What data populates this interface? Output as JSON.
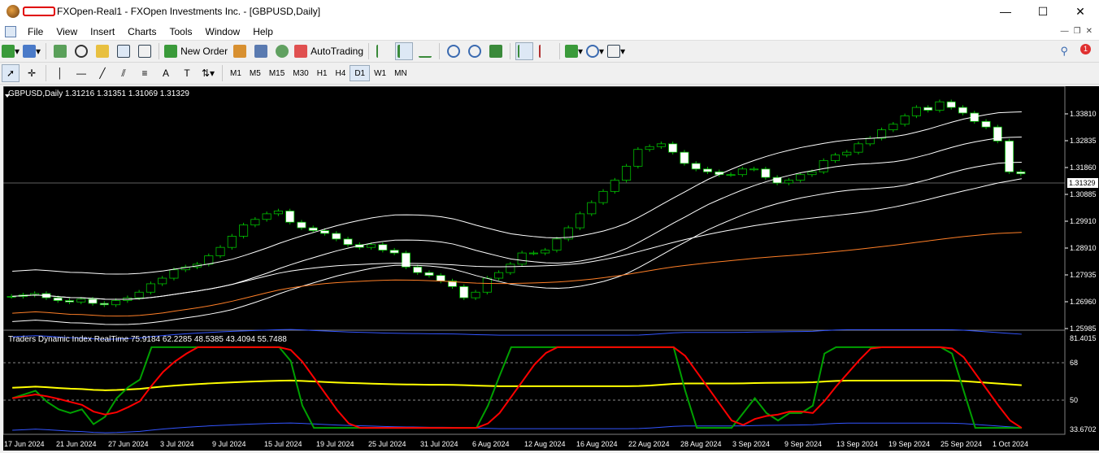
{
  "window": {
    "title": "FXOpen-Real1 - FXOpen Investments Inc. - [GBPUSD,Daily]",
    "minimize": "—",
    "maximize": "☐",
    "close": "✕"
  },
  "menu": [
    "File",
    "View",
    "Insert",
    "Charts",
    "Tools",
    "Window",
    "Help"
  ],
  "toolbar": {
    "new_order": "New Order",
    "autotrading": "AutoTrading",
    "timeframes": [
      "M1",
      "M5",
      "M15",
      "M30",
      "H1",
      "H4",
      "D1",
      "W1",
      "MN"
    ],
    "active_timeframe": "D1",
    "alerts_count": "1"
  },
  "chart": {
    "symbol_line": "GBPUSD,Daily  1.31216 1.31351 1.31069 1.31329",
    "current_price": "1.31329",
    "price_axis": [
      "1.33810",
      "1.32835",
      "1.31860",
      "1.30885",
      "1.29910",
      "1.28910",
      "1.27935",
      "1.26960",
      "1.25985"
    ],
    "date_axis": [
      "17 Jun 2024",
      "21 Jun 2024",
      "27 Jun 2024",
      "3 Jul 2024",
      "9 Jul 2024",
      "15 Jul 2024",
      "19 Jul 2024",
      "25 Jul 2024",
      "31 Jul 2024",
      "6 Aug 2024",
      "12 Aug 2024",
      "16 Aug 2024",
      "22 Aug 2024",
      "28 Aug 2024",
      "3 Sep 2024",
      "9 Sep 2024",
      "13 Sep 2024",
      "19 Sep 2024",
      "25 Sep 2024",
      "1 Oct 2024"
    ]
  },
  "indicator": {
    "label": "Traders Dynamic Index RealTime 75.9184 62.2285 48.5385 43.4094 55.7488",
    "axis": [
      "81.4015",
      "68",
      "50",
      "33.6702"
    ]
  },
  "colors": {
    "bull_candle": "#000000",
    "bear_candle": "#ffffff",
    "candle_outline": "#00c000",
    "bands": "#ffffff",
    "ma_long": "#ff7f27",
    "tdi_upper": "#3355ff",
    "tdi_mid": "#ffff00",
    "tdi_signal": "#ff0000",
    "tdi_rsi": "#00a000"
  }
}
